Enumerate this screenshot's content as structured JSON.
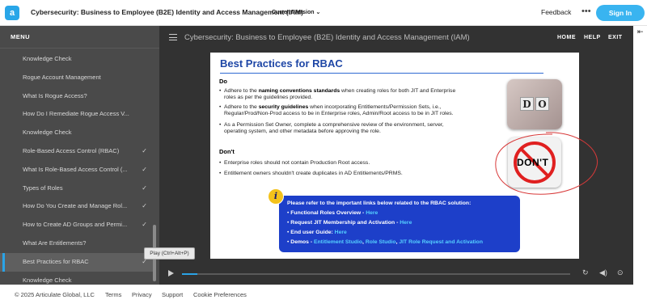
{
  "topbar": {
    "logo": "a",
    "title": "Cybersecurity: Business to Employee (B2E) Identity and Access Management (IAM)",
    "version": "Current Version",
    "feedback": "Feedback",
    "more": "•••",
    "signin": "Sign In"
  },
  "sidebar": {
    "header": "MENU",
    "items": [
      {
        "label": "Knowledge Check",
        "check": ""
      },
      {
        "label": "Rogue Account Management",
        "check": ""
      },
      {
        "label": "What Is Rogue Access?",
        "check": ""
      },
      {
        "label": "How Do I Remediate Rogue Access V...",
        "check": ""
      },
      {
        "label": "Knowledge Check",
        "check": ""
      },
      {
        "label": "Role-Based Access Control (RBAC)",
        "check": "✓"
      },
      {
        "label": "What Is Role-Based Access Control (...",
        "check": "✓"
      },
      {
        "label": "Types of Roles",
        "check": "✓"
      },
      {
        "label": "How Do You Create and Manage Rol...",
        "check": "✓"
      },
      {
        "label": "How to Create AD Groups and Permi...",
        "check": "✓"
      },
      {
        "label": "What Are Entitlements?",
        "check": ""
      },
      {
        "label": "Best Practices for RBAC",
        "check": "✓"
      },
      {
        "label": "Knowledge Check",
        "check": ""
      }
    ]
  },
  "tooltip": "Play (Ctrl+Alt+P)",
  "player": {
    "title": "Cybersecurity: Business to Employee (B2E) Identity and Access Management (IAM)",
    "home": "HOME",
    "help": "HELP",
    "exit": "EXIT",
    "collapse": "⇤",
    "progress": 0.04
  },
  "slide": {
    "title": "Best Practices for RBAC",
    "do_heading": "Do",
    "do_bullets": [
      {
        "pre": "Adhere to the ",
        "bold": "naming conventions standards",
        "post": " when creating roles for both JIT and Enterprise",
        "line2": "roles as per the guidelines provided.",
        "line3": ""
      },
      {
        "pre": "Adhere to the ",
        "bold": "security guidelines",
        "post": " when incorporating Entitlements/Permission Sets, i.e.,",
        "line2": "Regular/Prod/Non-Prod access to be in Enterprise roles, Admin/Root access to be in JIT roles.",
        "line3": ""
      },
      {
        "pre": "As a Permission Set Owner, complete a comprehensive review of the environment, server,",
        "bold": "",
        "post": "",
        "line2": "operating system, and other metadata before approving the role.",
        "line3": ""
      }
    ],
    "dont_heading": "Don't",
    "dont_bullets": [
      "Enterprise roles should not contain Production Root access.",
      "Entitlement owners shouldn't create duplicates in AD Entitlements/PRMS."
    ],
    "do_image_letters": [
      "D",
      "O"
    ],
    "dont_image_text": "DON'T",
    "info_icon": "i",
    "info": {
      "intro": "Please refer to the important links below related to the RBAC solution:",
      "l1_label": "Functional Roles Overview - ",
      "l1_link": "Here",
      "l2_label": "Request JIT Membership and Activation - ",
      "l2_link": "Here",
      "l3_label": "End user Guide: ",
      "l3_link": "Here",
      "l4_label": "Demos - ",
      "l4_link1": "Entitlement Studio",
      "l4_sep1": ", ",
      "l4_link2": "Role Studio",
      "l4_sep2": ", ",
      "l4_link3": "JIT Role Request and Activation"
    }
  },
  "footer": {
    "copyright": "© 2025 Articulate Global, LLC",
    "terms": "Terms",
    "privacy": "Privacy",
    "support": "Support",
    "cookies": "Cookie Preferences"
  }
}
